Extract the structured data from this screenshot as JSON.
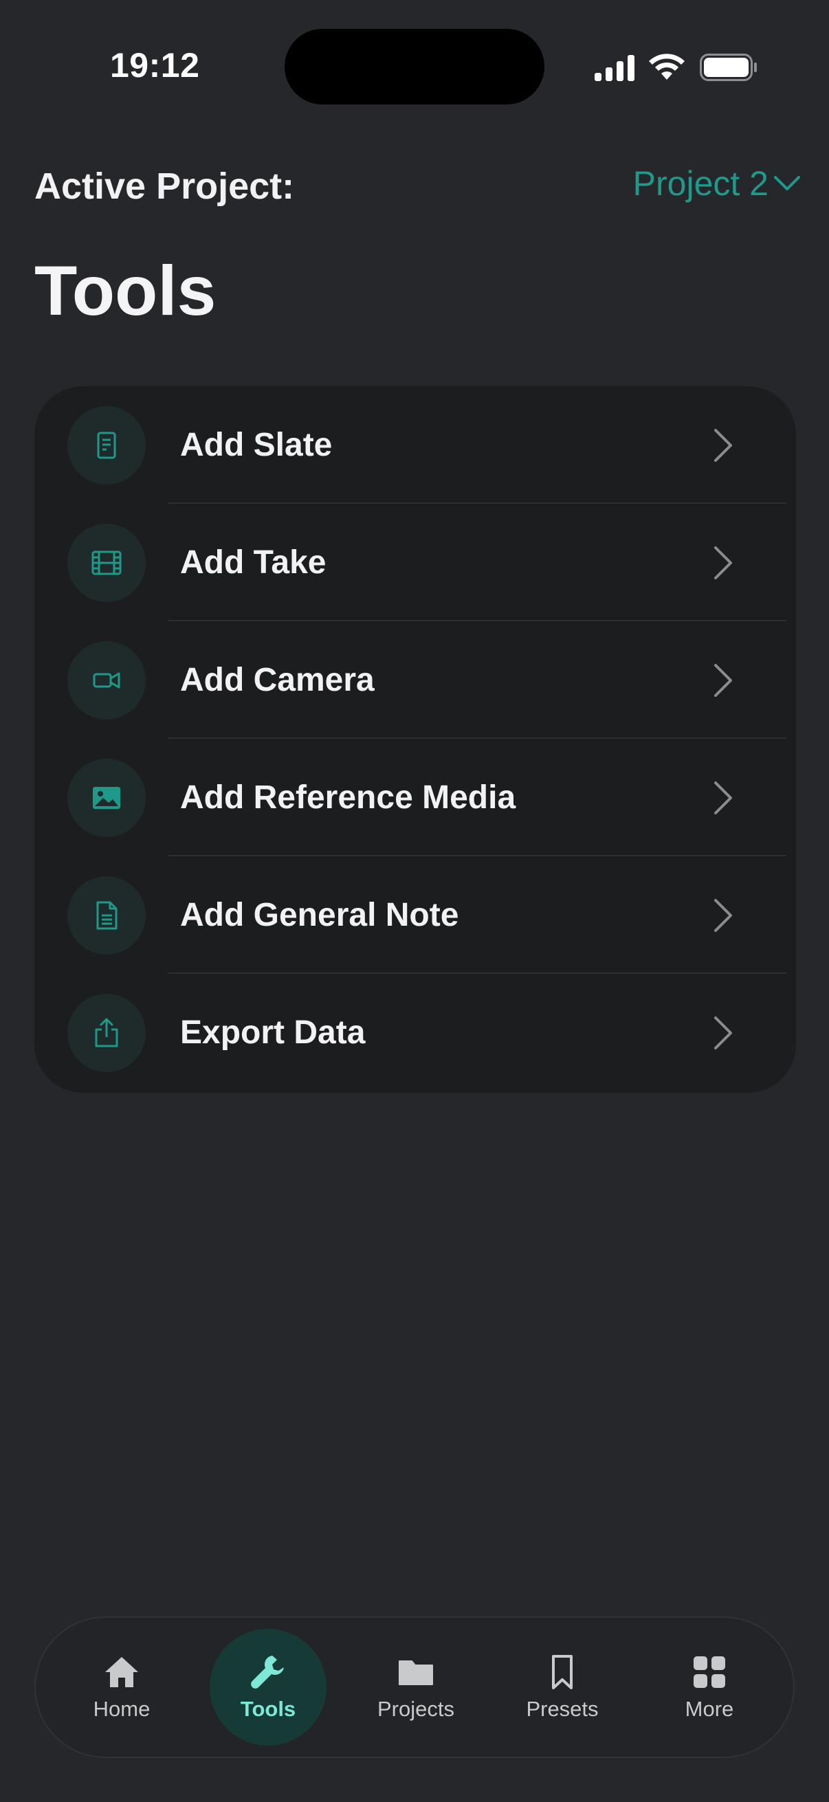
{
  "status_bar": {
    "time": "19:12"
  },
  "header": {
    "active_project_label": "Active Project:",
    "project_name": "Project 2",
    "title": "Tools"
  },
  "tools": [
    {
      "label": "Add Slate",
      "icon": "slate-icon"
    },
    {
      "label": "Add Take",
      "icon": "film-icon"
    },
    {
      "label": "Add Camera",
      "icon": "camera-icon"
    },
    {
      "label": "Add Reference Media",
      "icon": "image-icon"
    },
    {
      "label": "Add General Note",
      "icon": "note-icon"
    },
    {
      "label": "Export Data",
      "icon": "export-icon"
    }
  ],
  "tabbar": {
    "items": [
      {
        "label": "Home",
        "icon": "home-icon"
      },
      {
        "label": "Tools",
        "icon": "wrench-icon",
        "active": true
      },
      {
        "label": "Projects",
        "icon": "folder-icon"
      },
      {
        "label": "Presets",
        "icon": "bookmark-icon"
      },
      {
        "label": "More",
        "icon": "grid-icon"
      }
    ]
  },
  "colors": {
    "accent": "#1f9a8a",
    "background": "#26272a",
    "card": "#1c1d1f",
    "active_tab": "#7ee8d6"
  }
}
